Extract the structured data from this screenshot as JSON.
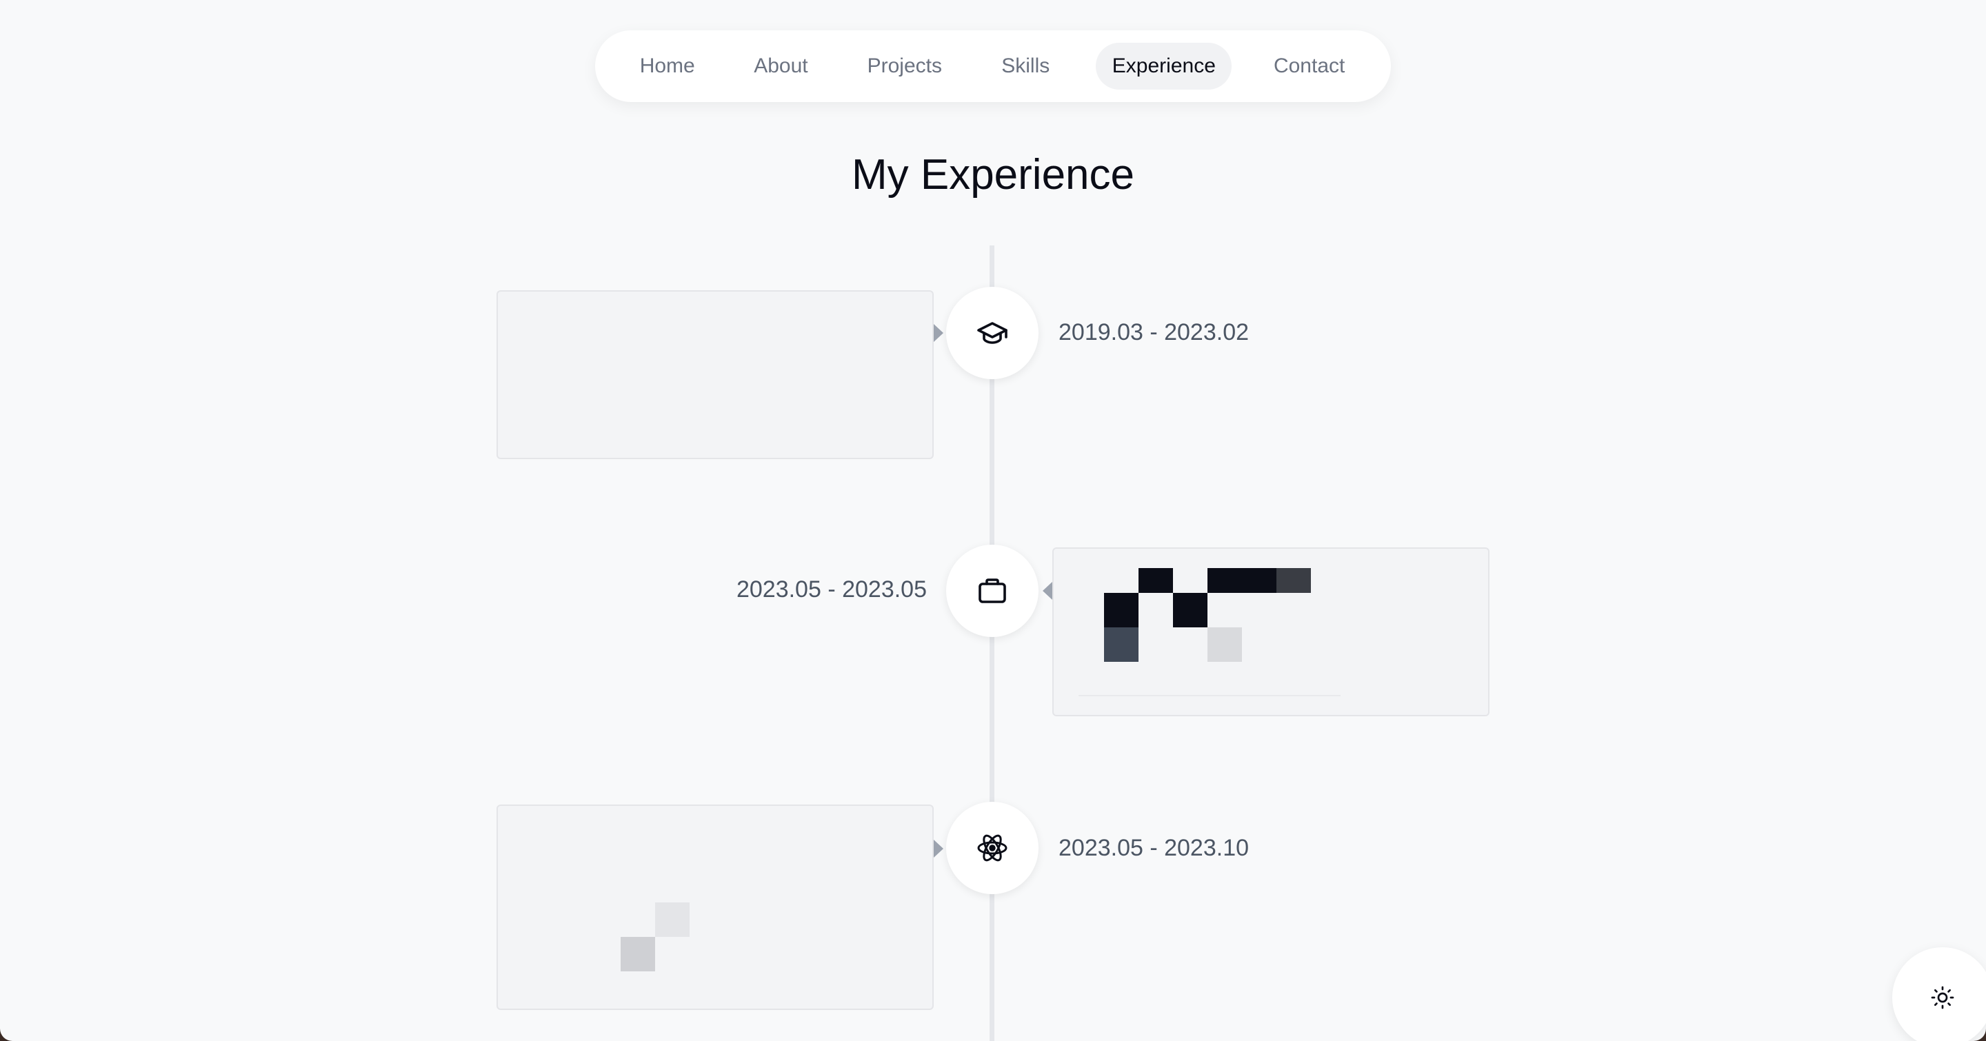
{
  "nav": {
    "items": [
      {
        "label": "Home"
      },
      {
        "label": "About"
      },
      {
        "label": "Projects"
      },
      {
        "label": "Skills"
      },
      {
        "label": "Experience",
        "active": true
      },
      {
        "label": "Contact"
      }
    ]
  },
  "page_title": "My Experience",
  "timeline": [
    {
      "icon": "graduation-cap-icon",
      "date": "2019.03 - 2023.02"
    },
    {
      "icon": "briefcase-icon",
      "date": "2023.05 - 2023.05"
    },
    {
      "icon": "react-atom-icon",
      "date": "2023.05 - 2023.10"
    }
  ],
  "theme_toggle": {
    "icon": "sun-icon"
  },
  "colors": {
    "background": "#f8f9fa",
    "text": "#0b0d17",
    "muted": "#4b5563",
    "card": "#f3f4f6"
  }
}
